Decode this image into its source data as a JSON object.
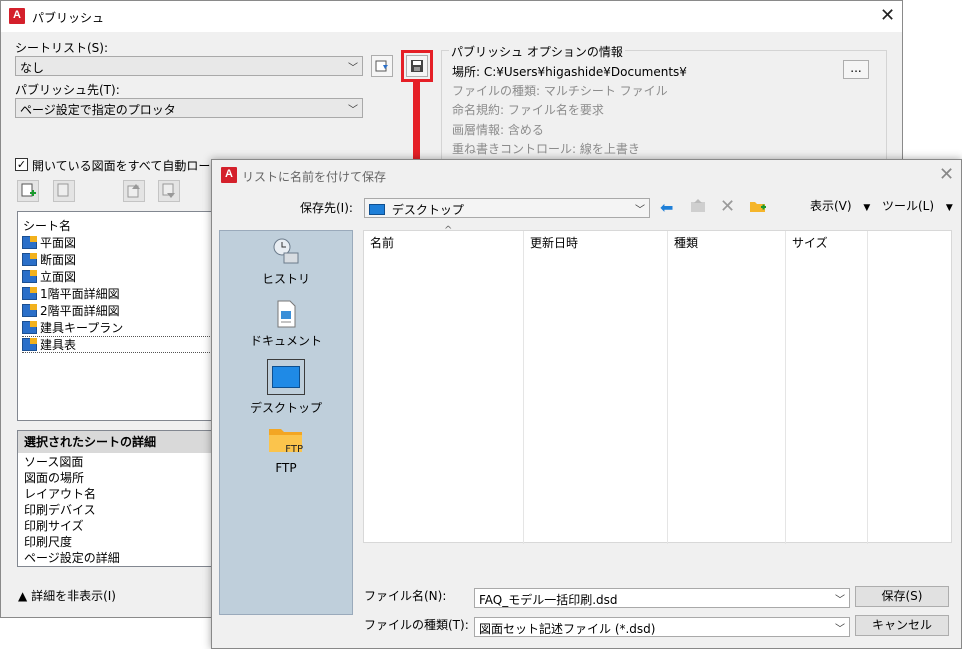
{
  "publish": {
    "title": "パブリッシュ",
    "sheet_list_label": "シートリスト(S):",
    "sheet_list_value": "なし",
    "publish_to_label": "パブリッシュ先(T):",
    "publish_to_value": "ページ設定で指定のプロッタ",
    "options_title": "パブリッシュ オプションの情報",
    "options": {
      "location": "場所: C:¥Users¥higashide¥Documents¥",
      "file_type": "ファイルの種類: マルチシート ファイル",
      "naming": "命名規約: ファイル名を要求",
      "layer_info": "画層情報: 含める",
      "overwrite": "重ね書きコントロール: 線を上書き",
      "browse_label": "..."
    },
    "auto_load_label": "開いている図面をすべて自動ロード(U)",
    "sheet_name_header": "シート名",
    "sheets": [
      "平面図",
      "断面図",
      "立面図",
      "1階平面詳細図",
      "2階平面詳細図",
      "建具キープラン",
      "建具表"
    ],
    "details_header": "選択されたシートの詳細",
    "details": [
      "ソース図面",
      "図面の場所",
      "レイアウト名",
      "印刷デバイス",
      "印刷サイズ",
      "印刷尺度",
      "ページ設定の詳細"
    ],
    "hide_details": "詳細を非表示(I)",
    "close": "✕"
  },
  "saveas": {
    "title": "リストに名前を付けて保存",
    "save_in_label": "保存先(I):",
    "save_in_value": "デスクトップ",
    "view_menu": "表示(V)",
    "tools_menu": "ツール(L)",
    "places": [
      {
        "label": "ヒストリ",
        "icon": "history-icon"
      },
      {
        "label": "ドキュメント",
        "icon": "documents-icon"
      },
      {
        "label": "デスクトップ",
        "icon": "desktop-icon"
      },
      {
        "label": "FTP",
        "icon": "ftp-icon",
        "badge": "FTP"
      }
    ],
    "columns": [
      "名前",
      "更新日時",
      "種類",
      "サイズ"
    ],
    "filename_label": "ファイル名(N):",
    "filename_value": "FAQ_モデル一括印刷.dsd",
    "filetype_label": "ファイルの種類(T):",
    "filetype_value": "図面セット記述ファイル (*.dsd)",
    "save_button": "保存(S)",
    "cancel_button": "キャンセル",
    "close": "✕"
  },
  "colors": {
    "highlight": "#e51f26",
    "app_red": "#d4202b",
    "places_bg": "#bfcfdb"
  }
}
